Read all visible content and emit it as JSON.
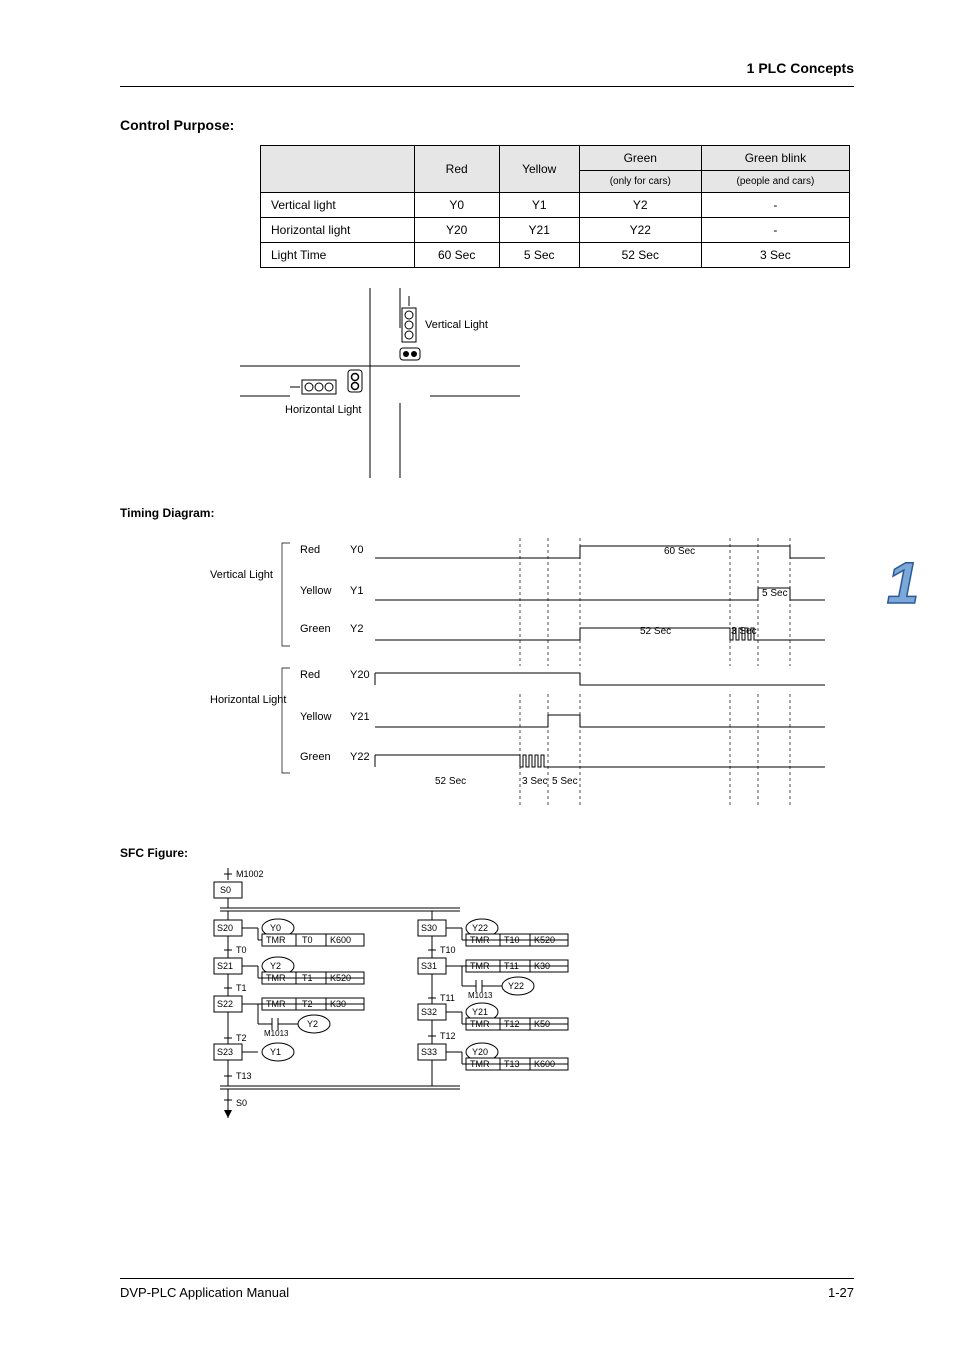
{
  "header": "1 PLC Concepts",
  "control_purpose": "Control Purpose:",
  "table": {
    "headers": {
      "red": "Red",
      "yellow": "Yellow",
      "green": "Green",
      "green_blink": "Green blink",
      "green_sub": "(only for cars)",
      "green_blink_sub": "(people and cars)"
    },
    "rows": [
      {
        "label": "Vertical light",
        "red": "Y0",
        "yellow": "Y1",
        "green": "Y2",
        "green_blink": "-"
      },
      {
        "label": "Horizontal light",
        "red": "Y20",
        "yellow": "Y21",
        "green": "Y22",
        "green_blink": "-"
      },
      {
        "label": "Light Time",
        "red": "60 Sec",
        "yellow": "5 Sec",
        "green": "52 Sec",
        "green_blink": "3 Sec"
      }
    ]
  },
  "vertical_light_label": "Vertical Light",
  "horizontal_light_label": "Horizontal Light",
  "timing": {
    "title": "Timing Diagram:",
    "vertical_group": "Vertical Light",
    "horizontal_group": "Horizontal Light",
    "signals": [
      {
        "name": "Red",
        "pin": "Y0"
      },
      {
        "name": "Yellow",
        "pin": "Y1"
      },
      {
        "name": "Green",
        "pin": "Y2"
      },
      {
        "name": "Red",
        "pin": "Y20"
      },
      {
        "name": "Yellow",
        "pin": "Y21"
      },
      {
        "name": "Green",
        "pin": "Y22"
      }
    ],
    "times": [
      "60 Sec",
      "5 Sec",
      "52 Sec",
      "3 Sec",
      "52 Sec",
      "3 Sec",
      "5 Sec"
    ]
  },
  "sfc": {
    "title": "SFC Figure:",
    "m1002": "M1002",
    "s0": "S0",
    "s20": "S20",
    "s21": "S21",
    "s22": "S22",
    "s23": "S23",
    "s30": "S30",
    "s31": "S31",
    "s32": "S32",
    "s33": "S33",
    "y0": "Y0",
    "y1": "Y1",
    "y2": "Y2",
    "y20": "Y20",
    "y21": "Y21",
    "y22": "Y22",
    "t0": "T0",
    "t1": "T1",
    "t2": "T2",
    "t10": "T10",
    "t11": "T11",
    "t12": "T12",
    "t13": "T13",
    "tmr_t0": {
      "cmd": "TMR",
      "arg1": "T0",
      "arg2": "K600"
    },
    "tmr_t1": {
      "cmd": "TMR",
      "arg1": "T1",
      "arg2": "K520"
    },
    "tmr_t2": {
      "cmd": "TMR",
      "arg1": "T2",
      "arg2": "K30"
    },
    "tmr_t10": {
      "cmd": "TMR",
      "arg1": "T10",
      "arg2": "K520"
    },
    "tmr_t11": {
      "cmd": "TMR",
      "arg1": "T11",
      "arg2": "K30"
    },
    "tmr_t12": {
      "cmd": "TMR",
      "arg1": "T12",
      "arg2": "K50"
    },
    "m1013_l": "M1013",
    "m1013_r": "M1013"
  },
  "footer": {
    "text": "DVP-PLC Application Manual",
    "page": "1-27"
  },
  "chapter_number": "1"
}
